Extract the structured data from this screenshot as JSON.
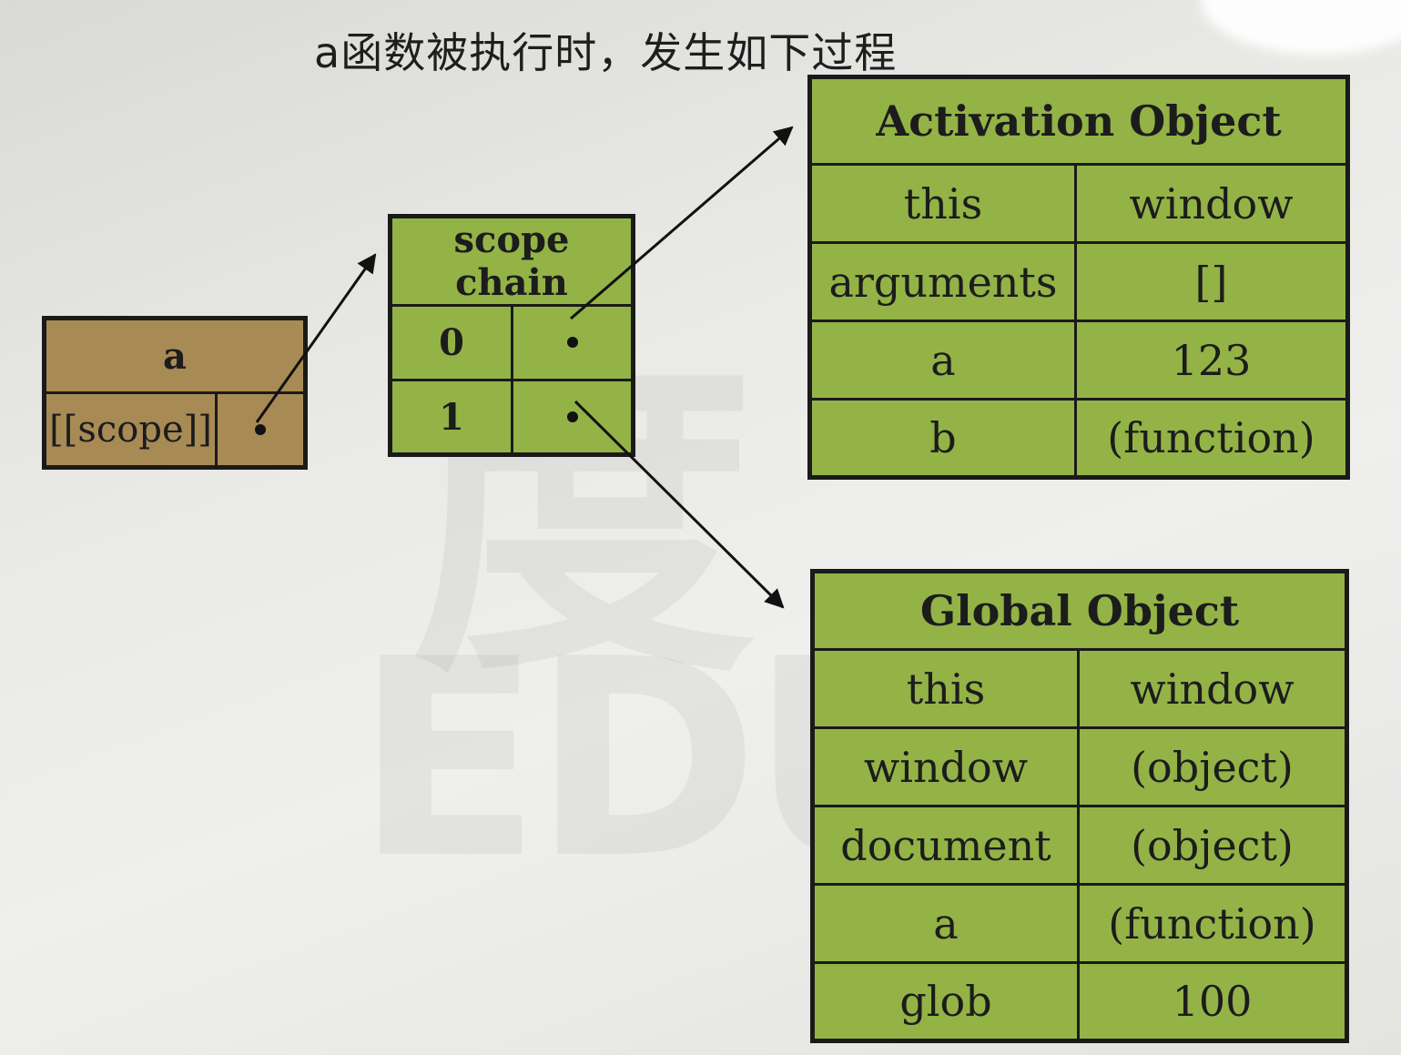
{
  "title": "a函数被执行时，发生如下过程",
  "watermark": {
    "line1": "EDUC",
    "line2": "度"
  },
  "function_box": {
    "header": "a",
    "scope_label": "[[scope]]"
  },
  "scope_chain": {
    "header": "scope chain",
    "rows": [
      "0",
      "1"
    ]
  },
  "activation_object": {
    "header": "Activation Object",
    "rows": [
      {
        "key": "this",
        "value": "window"
      },
      {
        "key": "arguments",
        "value": "[]"
      },
      {
        "key": "a",
        "value": "123"
      },
      {
        "key": "b",
        "value": "(function)"
      }
    ]
  },
  "global_object": {
    "header": "Global Object",
    "rows": [
      {
        "key": "this",
        "value": "window"
      },
      {
        "key": "window",
        "value": "(object)"
      },
      {
        "key": "document",
        "value": "(object)"
      },
      {
        "key": "a",
        "value": "(function)"
      },
      {
        "key": "glob",
        "value": "100"
      }
    ]
  },
  "colors": {
    "green": "#93b346",
    "brown": "#a88a55",
    "border": "#1a1a1a"
  }
}
